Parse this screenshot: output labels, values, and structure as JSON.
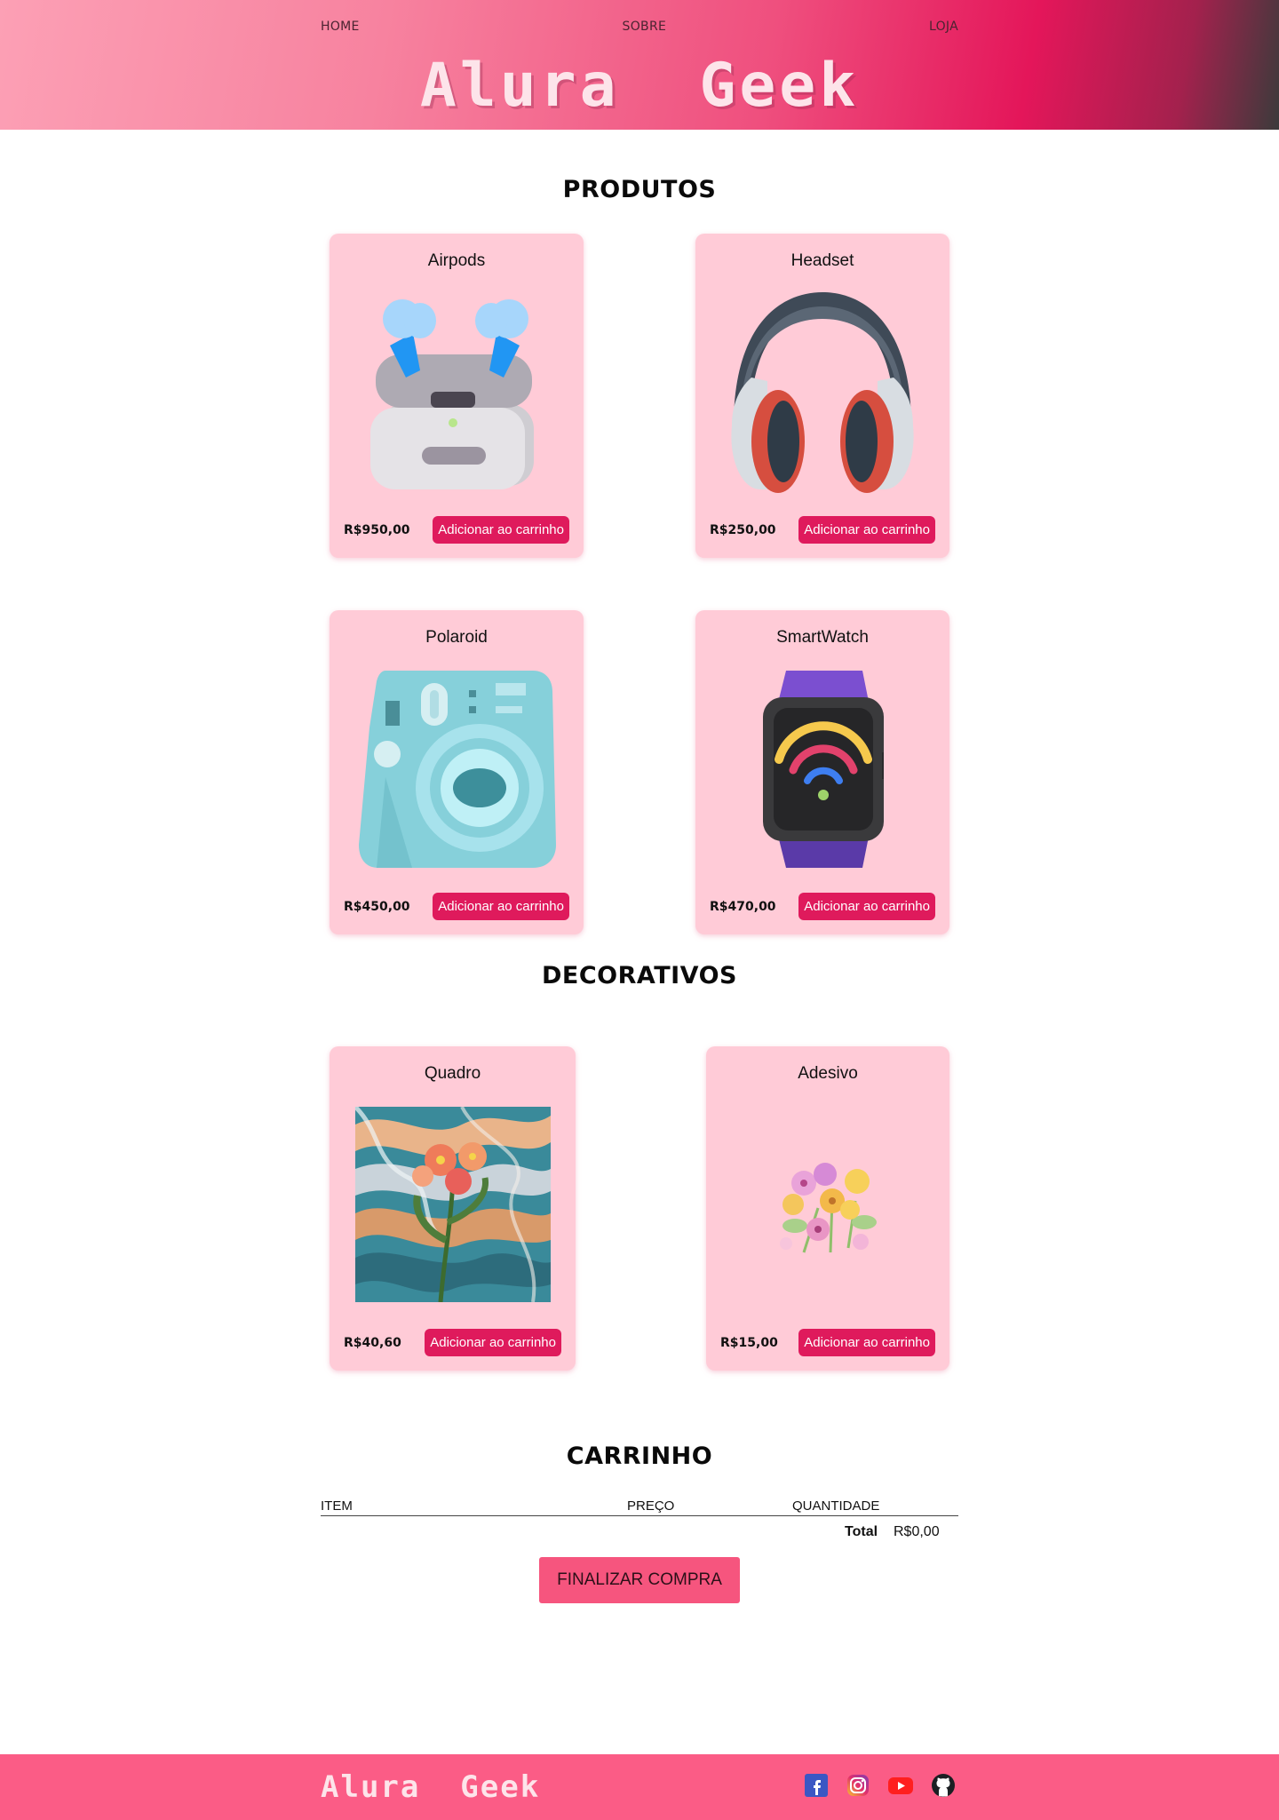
{
  "header": {
    "nav": [
      "HOME",
      "SOBRE",
      "LOJA"
    ],
    "logo": "Alura  Geek"
  },
  "produtos": {
    "title": "PRODUTOS",
    "items": [
      {
        "name": "Airpods",
        "price": "R$950,00",
        "button": "Adicionar ao carrinho",
        "icon": "airpods-icon"
      },
      {
        "name": "Headset",
        "price": "R$250,00",
        "button": "Adicionar ao carrinho",
        "icon": "headset-icon"
      },
      {
        "name": "Polaroid",
        "price": "R$450,00",
        "button": "Adicionar ao carrinho",
        "icon": "polaroid-camera-icon"
      },
      {
        "name": "SmartWatch",
        "price": "R$470,00",
        "button": "Adicionar ao carrinho",
        "icon": "smartwatch-icon"
      }
    ]
  },
  "decorativos": {
    "title": "DECORATIVOS",
    "items": [
      {
        "name": "Quadro",
        "price": "R$40,60",
        "button": "Adicionar ao carrinho",
        "icon": "flower-painting-image"
      },
      {
        "name": "Adesivo",
        "price": "R$15,00",
        "button": "Adicionar ao carrinho",
        "icon": "flower-sticker-image"
      }
    ]
  },
  "cart": {
    "title": "CARRINHO",
    "columns": [
      "ITEM",
      "PREÇO",
      "QUANTIDADE"
    ],
    "total_label": "Total",
    "total_value": "R$0,00",
    "checkout": "FINALIZAR COMPRA"
  },
  "footer": {
    "logo": "Alura  Geek",
    "social": [
      "facebook-icon",
      "instagram-icon",
      "youtube-icon",
      "github-icon"
    ]
  },
  "colors": {
    "card_bg": "#ffcbd7",
    "button": "#df1a5c",
    "checkout": "#f6557e",
    "footer": "#fb5c86"
  }
}
